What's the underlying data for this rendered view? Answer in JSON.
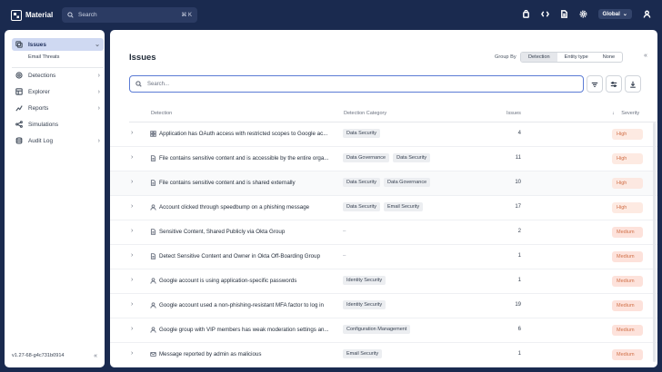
{
  "app": {
    "title": "Material"
  },
  "search": {
    "placeholder": "Search",
    "shortcut": "⌘ K"
  },
  "topbar": {
    "scope_label": "Global"
  },
  "sidebar": {
    "items": [
      {
        "label": "Issues",
        "icon": "issues-icon",
        "active": true
      },
      {
        "label": "Detections",
        "icon": "detections-icon"
      },
      {
        "label": "Explorer",
        "icon": "explorer-icon"
      },
      {
        "label": "Reports",
        "icon": "reports-icon"
      },
      {
        "label": "Simulations",
        "icon": "simulations-icon"
      },
      {
        "label": "Audit Log",
        "icon": "audit-log-icon"
      }
    ],
    "subitem": "Email Threats",
    "version": "v1.27-68-g4c731b0914"
  },
  "main": {
    "title": "Issues",
    "group_by_label": "Group By",
    "group_by_options": [
      "Detection",
      "Entity type",
      "None"
    ],
    "filter_placeholder": "Search...",
    "columns": {
      "detection": "Detection",
      "category": "Detection Category",
      "issues": "Issues",
      "severity": "Severity"
    },
    "rows": [
      {
        "icon": "grid-icon",
        "detection": "Application has OAuth access with restricted scopes to Google ac...",
        "categories": [
          "Data Security"
        ],
        "issues": "4",
        "severity": "High"
      },
      {
        "icon": "file-icon",
        "detection": "File contains sensitive content and is accessible by the entire orga...",
        "categories": [
          "Data Governance",
          "Data Security"
        ],
        "issues": "11",
        "severity": "High"
      },
      {
        "icon": "file-icon",
        "detection": "File contains sensitive content and is shared externally",
        "categories": [
          "Data Security",
          "Data Governance"
        ],
        "issues": "10",
        "severity": "High"
      },
      {
        "icon": "user-icon",
        "detection": "Account clicked through speedbump on a phishing message",
        "categories": [
          "Data Security",
          "Email Security"
        ],
        "issues": "17",
        "severity": "High"
      },
      {
        "icon": "file-icon",
        "detection": "Sensitive Content, Shared Publicly via Okta Group",
        "categories": [],
        "issues": "2",
        "severity": "Medium"
      },
      {
        "icon": "file-icon",
        "detection": "Detect Sensitive Content and Owner in Okta Off-Boarding Group",
        "categories": [],
        "issues": "1",
        "severity": "Medium"
      },
      {
        "icon": "user-icon",
        "detection": "Google account is using application-specific passwords",
        "categories": [
          "Identity Security"
        ],
        "issues": "1",
        "severity": "Medium"
      },
      {
        "icon": "user-icon",
        "detection": "Google account used a non-phishing-resistant MFA factor to log in",
        "categories": [
          "Identity Security"
        ],
        "issues": "19",
        "severity": "Medium"
      },
      {
        "icon": "user-icon",
        "detection": "Google group with VIP members has weak moderation settings an...",
        "categories": [
          "Configuration Management"
        ],
        "issues": "6",
        "severity": "Medium"
      },
      {
        "icon": "mail-icon",
        "detection": "Message reported by admin as malicious",
        "categories": [
          "Email Security"
        ],
        "issues": "1",
        "severity": "Medium"
      }
    ]
  },
  "colors": {
    "topbar": "#1a2a4f",
    "accent": "#5b7bd5",
    "severity_high": "#fde3d9",
    "severity_medium": "#fdd9cf"
  }
}
